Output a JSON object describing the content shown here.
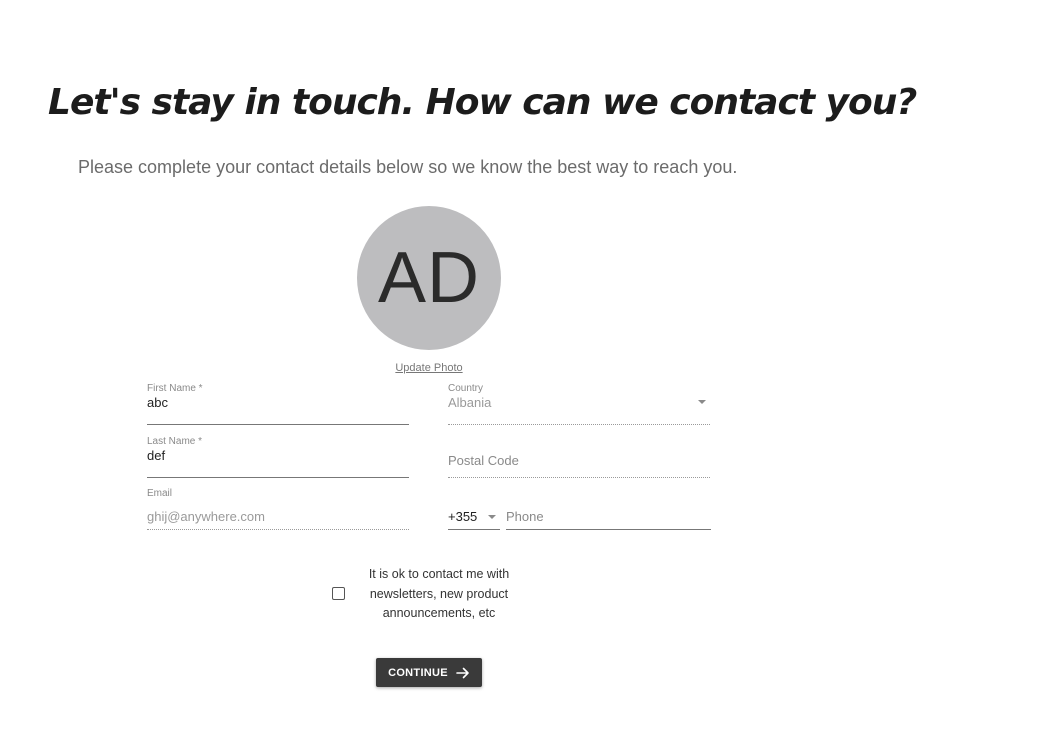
{
  "header": {
    "title": "Let's stay in touch. How can we contact you?",
    "subtitle": "Please complete your contact details below so we know the best way to reach you."
  },
  "avatar": {
    "initials": "AD",
    "update_photo_label": "Update Photo"
  },
  "form": {
    "first_name": {
      "label": "First Name *",
      "value": "abc"
    },
    "last_name": {
      "label": "Last Name *",
      "value": "def"
    },
    "email": {
      "label": "Email",
      "value": "ghij@anywhere.com"
    },
    "country": {
      "label": "Country",
      "value": "Albania"
    },
    "postal_code": {
      "placeholder": "Postal Code"
    },
    "phone_code": {
      "value": "+355"
    },
    "phone": {
      "placeholder": "Phone"
    }
  },
  "consent": {
    "checked": false,
    "label": "It is ok to contact me with newsletters, new product announcements, etc"
  },
  "continue_button": {
    "label": "CONTINUE",
    "icon": "arrow-right-icon"
  },
  "colors": {
    "button_bg": "#3a3a3a",
    "avatar_bg": "#bdbdbf"
  }
}
